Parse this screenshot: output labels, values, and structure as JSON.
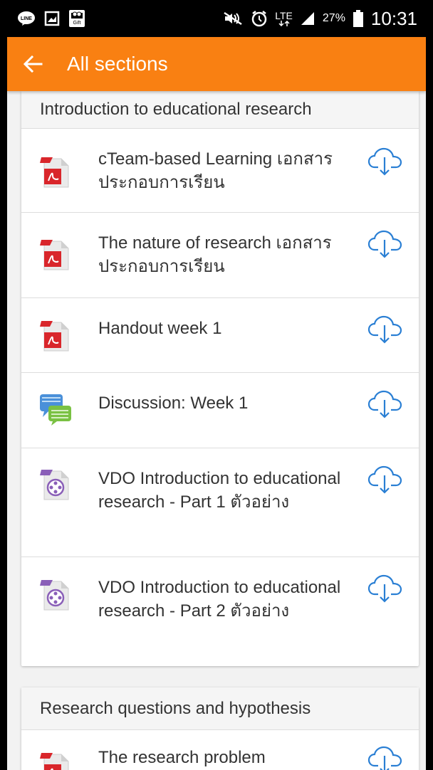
{
  "status_bar": {
    "signal_label": "LTE",
    "battery": "27%",
    "time": "10:31",
    "icons": [
      "line-app-icon",
      "image-icon",
      "gift-app-icon",
      "mute-icon",
      "alarm-icon",
      "lte-icon",
      "signal-icon",
      "battery-icon"
    ],
    "gift_label": "Gift"
  },
  "app_bar": {
    "title": "All sections",
    "background": "#f98012",
    "back_icon": "back-arrow-icon"
  },
  "sections": [
    {
      "title": "Introduction to educational research",
      "items": [
        {
          "icon": "pdf-icon",
          "name": "cTeam-based Learning เอกสารประกอบการเรียน",
          "download_icon": "cloud-download-icon"
        },
        {
          "icon": "pdf-icon",
          "name": "The nature of research เอกสารประกอบการเรียน",
          "download_icon": "cloud-download-icon"
        },
        {
          "icon": "pdf-icon",
          "name": "Handout week 1",
          "download_icon": "cloud-download-icon"
        },
        {
          "icon": "forum-icon",
          "name": "Discussion: Week 1",
          "download_icon": "cloud-download-icon"
        },
        {
          "icon": "video-icon",
          "name": "VDO Introduction to educational research - Part 1 ตัวอย่าง",
          "download_icon": "cloud-download-icon"
        },
        {
          "icon": "video-icon",
          "name": "VDO Introduction to educational research - Part 2 ตัวอย่าง",
          "download_icon": "cloud-download-icon"
        }
      ]
    },
    {
      "title": "Research questions and hypothesis",
      "items": [
        {
          "icon": "pdf-icon",
          "name": "The research problem",
          "download_icon": "cloud-download-icon"
        }
      ]
    }
  ],
  "colors": {
    "accent": "#f98012",
    "download_icon": "#2a7fd4",
    "pdf_red": "#d9262b",
    "forum_blue": "#4a90d9",
    "forum_green": "#7ac143",
    "video_purple": "#8a5fb8"
  }
}
